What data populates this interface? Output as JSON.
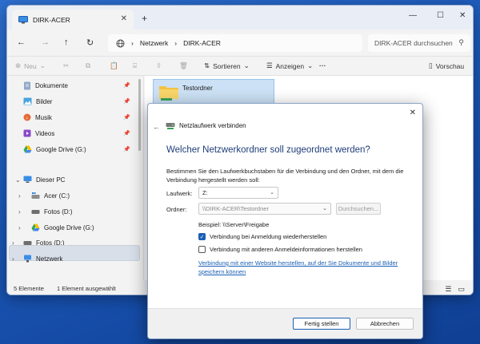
{
  "tab": {
    "title": "DIRK-ACER"
  },
  "address": {
    "segments": [
      "Netzwerk",
      "DIRK-ACER"
    ],
    "search_placeholder": "DIRK-ACER durchsuchen"
  },
  "toolbar": {
    "new_label": "Neu",
    "sort_label": "Sortieren",
    "view_label": "Anzeigen",
    "more_label": "···",
    "preview_label": "Vorschau"
  },
  "sidebar": {
    "quick": [
      {
        "label": "Dokumente"
      },
      {
        "label": "Bilder"
      },
      {
        "label": "Musik"
      },
      {
        "label": "Videos"
      },
      {
        "label": "Google Drive (G:)"
      }
    ],
    "this_pc": "Dieser PC",
    "drives": [
      {
        "label": "Acer (C:)"
      },
      {
        "label": "Fotos (D:)"
      },
      {
        "label": "Google Drive (G:)"
      }
    ],
    "fotos_root": "Fotos (D:)",
    "network": "Netzwerk"
  },
  "content": {
    "folder_name": "Testordner"
  },
  "status": {
    "count": "5 Elemente",
    "selected": "1 Element ausgewählt"
  },
  "dialog": {
    "title": "Netzlaufwerk verbinden",
    "heading": "Welcher Netzwerkordner soll zugeordnet werden?",
    "description": "Bestimmen Sie den Laufwerkbuchstaben für die Verbindung und den Ordner, mit dem die Verbindung hergestellt werden soll:",
    "drive_label": "Laufwerk:",
    "drive_value": "Z:",
    "folder_label": "Ordner:",
    "folder_value": "\\\\DIRK-ACER\\Testordner",
    "browse_label": "Durchsuchen...",
    "example": "Beispiel: \\\\Server\\Freigabe",
    "reconnect_label": "Verbindung bei Anmeldung wiederherstellen",
    "reconnect_checked": true,
    "other_creds_label": "Verbindung mit anderen Anmeldeinformationen herstellen",
    "other_creds_checked": false,
    "link": "Verbindung mit einer Website herstellen, auf der Sie Dokumente und Bilder speichern können",
    "finish_label": "Fertig stellen",
    "cancel_label": "Abbrechen"
  },
  "colors": {
    "accent": "#1a5fb4",
    "heading": "#1e3d7a",
    "folder": "#f4c342"
  }
}
